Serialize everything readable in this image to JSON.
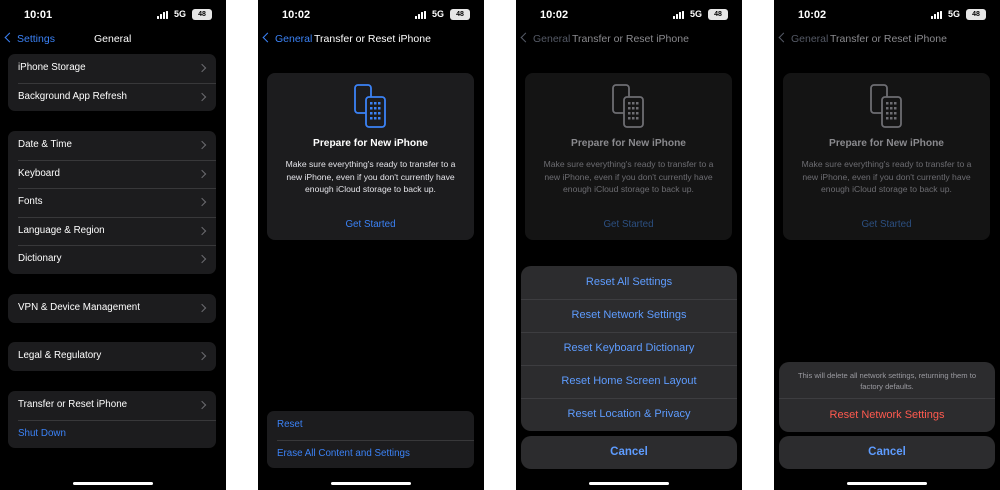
{
  "screens": [
    {
      "time": "10:01",
      "network": "5G",
      "battery": "48",
      "back_label": "Settings",
      "title": "General",
      "groups": [
        {
          "rows": [
            "iPhone Storage",
            "Background App Refresh"
          ]
        },
        {
          "rows": [
            "Date & Time",
            "Keyboard",
            "Fonts",
            "Language & Region",
            "Dictionary"
          ]
        },
        {
          "rows": [
            "VPN & Device Management"
          ]
        },
        {
          "rows": [
            "Legal & Regulatory"
          ]
        },
        {
          "rows": [
            "Transfer or Reset iPhone",
            "Shut Down"
          ]
        }
      ]
    },
    {
      "time": "10:02",
      "network": "5G",
      "battery": "48",
      "back_label": "General",
      "title": "Transfer or Reset iPhone",
      "card": {
        "title": "Prepare for New iPhone",
        "body": "Make sure everything's ready to transfer to a new iPhone, even if you don't currently have enough iCloud storage to back up.",
        "button": "Get Started"
      },
      "reset_rows": [
        "Reset",
        "Erase All Content and Settings"
      ]
    },
    {
      "time": "10:02",
      "network": "5G",
      "battery": "48",
      "back_label": "General",
      "title": "Transfer or Reset iPhone",
      "card": {
        "title": "Prepare for New iPhone",
        "body": "Make sure everything's ready to transfer to a new iPhone, even if you don't currently have enough iCloud storage to back up.",
        "button": "Get Started"
      },
      "actions": [
        "Reset All Settings",
        "Reset Network Settings",
        "Reset Keyboard Dictionary",
        "Reset Home Screen Layout",
        "Reset Location & Privacy"
      ],
      "cancel": "Cancel"
    },
    {
      "time": "10:02",
      "network": "5G",
      "battery": "48",
      "back_label": "General",
      "title": "Transfer or Reset iPhone",
      "card": {
        "title": "Prepare for New iPhone",
        "body": "Make sure everything's ready to transfer to a new iPhone, even if you don't currently have enough iCloud storage to back up.",
        "button": "Get Started"
      },
      "confirm_message": "This will delete all network settings, returning them to factory defaults.",
      "confirm_action": "Reset Network Settings",
      "cancel": "Cancel"
    }
  ],
  "colors": {
    "accent": "#3b82f6",
    "destructive": "#ff5a4f",
    "cell": "#1c1c1e",
    "sheet": "#2c2c2e"
  }
}
